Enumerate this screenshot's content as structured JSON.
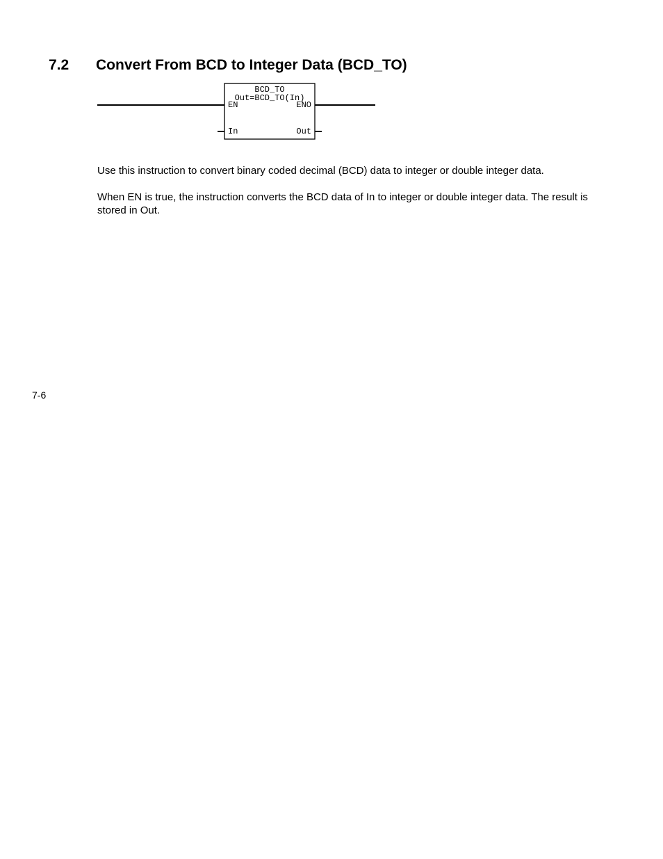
{
  "section": {
    "number": "7.2",
    "title": "Convert From BCD to Integer Data (BCD_TO)"
  },
  "diagram": {
    "title": "BCD_TO",
    "expr": "Out=BCD_TO(In)",
    "en": "EN",
    "eno": "ENO",
    "in": "In",
    "out": "Out"
  },
  "paragraphs": {
    "p1": "Use this instruction to convert binary coded decimal (BCD) data to integer or double integer data.",
    "p2": "When EN is true, the instruction converts the BCD data of In to integer or double integer data. The result is stored in Out."
  },
  "page_number": "7-6"
}
